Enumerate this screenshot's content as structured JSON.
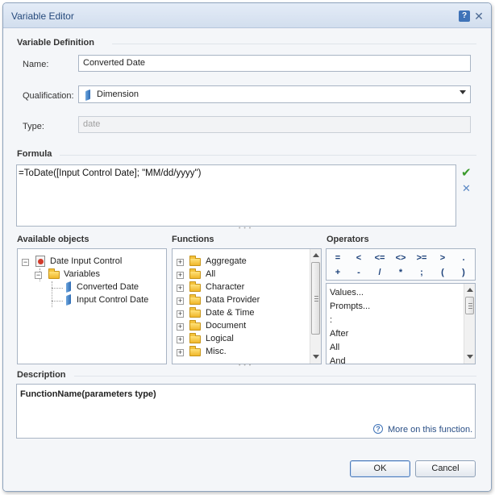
{
  "window": {
    "title": "Variable Editor"
  },
  "definition": {
    "heading": "Variable Definition",
    "name_label": "Name:",
    "name_value": "Converted Date",
    "qualification_label": "Qualification:",
    "qualification_value": "Dimension",
    "type_label": "Type:",
    "type_value": "date"
  },
  "formula": {
    "heading": "Formula",
    "text": "=ToDate([Input Control Date]; \"MM/dd/yyyy\")"
  },
  "available_objects": {
    "heading": "Available objects",
    "root": "Date Input Control",
    "folder": "Variables",
    "items": [
      "Converted Date",
      "Input Control Date"
    ]
  },
  "functions": {
    "heading": "Functions",
    "items": [
      "Aggregate",
      "All",
      "Character",
      "Data Provider",
      "Date & Time",
      "Document",
      "Logical",
      "Misc."
    ]
  },
  "operators": {
    "heading": "Operators",
    "row1": [
      "=",
      "<",
      "<=",
      "<>",
      ">=",
      ">",
      "."
    ],
    "row2": [
      "+",
      "-",
      "/",
      "*",
      ";",
      "(",
      ")"
    ],
    "list": [
      "Values...",
      "Prompts...",
      ":",
      "After",
      "All",
      "And"
    ]
  },
  "description": {
    "heading": "Description",
    "signature": "FunctionName(parameters type)",
    "more_link": "More on this function."
  },
  "buttons": {
    "ok": "OK",
    "cancel": "Cancel"
  },
  "colors": {
    "accent": "#3f73b8",
    "validate_green": "#3a9a2c"
  }
}
